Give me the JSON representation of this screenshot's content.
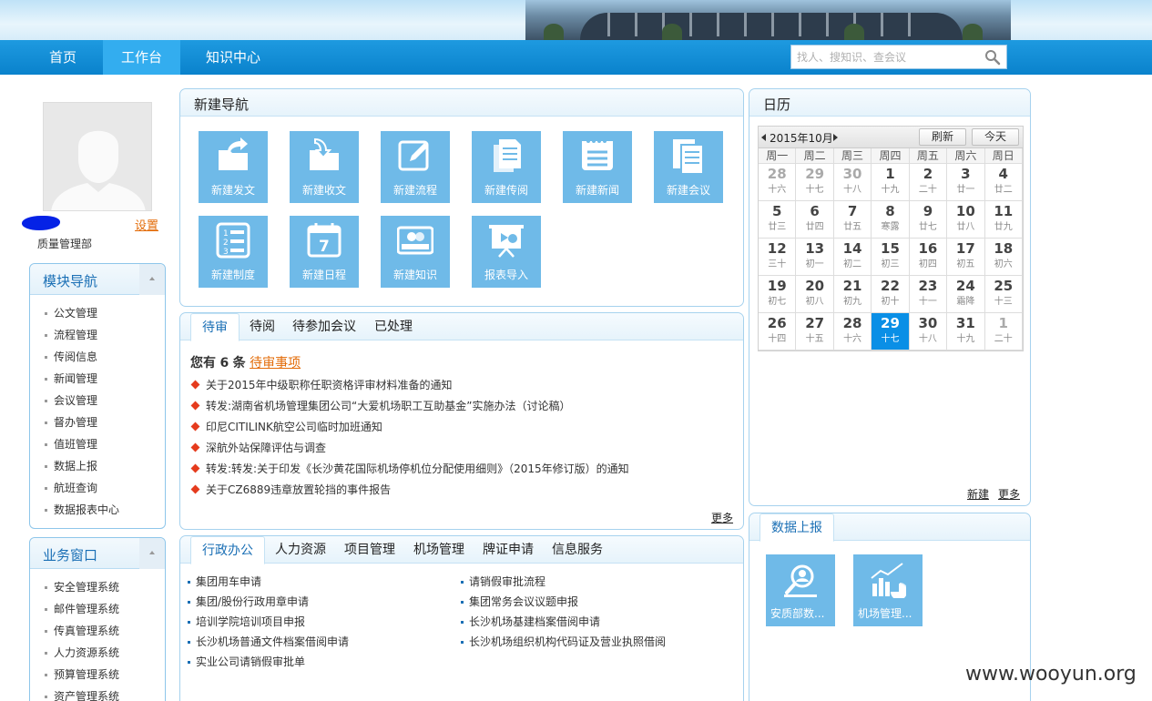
{
  "nav": {
    "items": [
      {
        "label": "首页"
      },
      {
        "label": "工作台"
      },
      {
        "label": "知识中心"
      }
    ],
    "active_index": 1,
    "search_placeholder": "找人、搜知识、查会议"
  },
  "profile": {
    "settings_label": "设置",
    "department": "质量管理部"
  },
  "module_nav": {
    "title": "模块导航",
    "items": [
      "公文管理",
      "流程管理",
      "传阅信息",
      "新闻管理",
      "会议管理",
      "督办管理",
      "值班管理",
      "数据上报",
      "航班查询",
      "数据报表中心"
    ]
  },
  "business_window": {
    "title": "业务窗口",
    "items": [
      "安全管理系统",
      "邮件管理系统",
      "传真管理系统",
      "人力资源系统",
      "预算管理系统",
      "资产管理系统"
    ]
  },
  "new_nav": {
    "title": "新建导航",
    "tiles": [
      {
        "label": "新建发文",
        "icon": "folder-send-icon"
      },
      {
        "label": "新建收文",
        "icon": "folder-receive-icon"
      },
      {
        "label": "新建流程",
        "icon": "edit-icon"
      },
      {
        "label": "新建传阅",
        "icon": "documents-icon"
      },
      {
        "label": "新建新闻",
        "icon": "news-icon"
      },
      {
        "label": "新建会议",
        "icon": "meeting-doc-icon"
      },
      {
        "label": "新建制度",
        "icon": "numbered-list-icon"
      },
      {
        "label": "新建日程",
        "icon": "calendar-icon"
      },
      {
        "label": "新建知识",
        "icon": "card-icon"
      },
      {
        "label": "报表导入",
        "icon": "presentation-icon"
      }
    ]
  },
  "todo": {
    "tabs": [
      "待审",
      "待阅",
      "待参加会议",
      "已处理"
    ],
    "active_tab": 0,
    "summary_prefix": "您有",
    "count": "6",
    "summary_unit": "条",
    "summary_link": "待审事项",
    "items": [
      "关于2015年中级职称任职资格评审材料准备的通知",
      "转发:湖南省机场管理集团公司“大爱机场职工互助基金”实施办法（讨论稿）",
      "印尼CITILINK航空公司临时加班通知",
      "深航外站保障评估与调查",
      "转发:转发:关于印发《长沙黄花国际机场停机位分配使用细则》（2015年修订版）的通知",
      "关于CZ6889违章放置轮挡的事件报告"
    ],
    "more_label": "更多"
  },
  "services": {
    "tabs": [
      "行政办公",
      "人力资源",
      "项目管理",
      "机场管理",
      "牌证申请",
      "信息服务"
    ],
    "active_tab": 0,
    "left_links": [
      "集团用车申请",
      "集团/股份行政用章申请",
      "培训学院培训项目申报",
      "长沙机场普通文件档案借阅申请",
      "实业公司请销假审批单"
    ],
    "right_links": [
      "请销假审批流程",
      "集团常务会议议题申报",
      "长沙机场基建档案借阅申请",
      "长沙机场组织机构代码证及营业执照借阅"
    ]
  },
  "calendar": {
    "title": "日历",
    "month_label": "2015年10月",
    "refresh_label": "刷新",
    "today_label": "今天",
    "weekdays": [
      "周一",
      "周二",
      "周三",
      "周四",
      "周五",
      "周六",
      "周日"
    ],
    "days": [
      {
        "n": "28",
        "l": "十六",
        "other": true
      },
      {
        "n": "29",
        "l": "十七",
        "other": true
      },
      {
        "n": "30",
        "l": "十八",
        "other": true
      },
      {
        "n": "1",
        "l": "十九"
      },
      {
        "n": "2",
        "l": "二十"
      },
      {
        "n": "3",
        "l": "廿一"
      },
      {
        "n": "4",
        "l": "廿二"
      },
      {
        "n": "5",
        "l": "廿三"
      },
      {
        "n": "6",
        "l": "廿四"
      },
      {
        "n": "7",
        "l": "廿五"
      },
      {
        "n": "8",
        "l": "寒露"
      },
      {
        "n": "9",
        "l": "廿七"
      },
      {
        "n": "10",
        "l": "廿八"
      },
      {
        "n": "11",
        "l": "廿九"
      },
      {
        "n": "12",
        "l": "三十"
      },
      {
        "n": "13",
        "l": "初一"
      },
      {
        "n": "14",
        "l": "初二"
      },
      {
        "n": "15",
        "l": "初三"
      },
      {
        "n": "16",
        "l": "初四"
      },
      {
        "n": "17",
        "l": "初五"
      },
      {
        "n": "18",
        "l": "初六"
      },
      {
        "n": "19",
        "l": "初七"
      },
      {
        "n": "20",
        "l": "初八"
      },
      {
        "n": "21",
        "l": "初九"
      },
      {
        "n": "22",
        "l": "初十"
      },
      {
        "n": "23",
        "l": "十一"
      },
      {
        "n": "24",
        "l": "霜降"
      },
      {
        "n": "25",
        "l": "十三"
      },
      {
        "n": "26",
        "l": "十四"
      },
      {
        "n": "27",
        "l": "十五"
      },
      {
        "n": "28",
        "l": "十六"
      },
      {
        "n": "29",
        "l": "十七",
        "today": true
      },
      {
        "n": "30",
        "l": "十八"
      },
      {
        "n": "31",
        "l": "十九"
      },
      {
        "n": "1",
        "l": "二十",
        "other": true
      }
    ],
    "new_label": "新建",
    "more_label": "更多"
  },
  "data_report": {
    "title": "数据上报",
    "tiles": [
      {
        "label": "安质部数...",
        "icon": "magnifier-person-icon"
      },
      {
        "label": "机场管理...",
        "icon": "chart-icon"
      }
    ]
  },
  "watermark": "www.wooyun.org",
  "colors": {
    "nav_bar": "#0a82cc",
    "tile": "#6fbae8",
    "accent_orange": "#e36c09",
    "today": "#0a8fe6",
    "bullet_red": "#e53b1d"
  }
}
